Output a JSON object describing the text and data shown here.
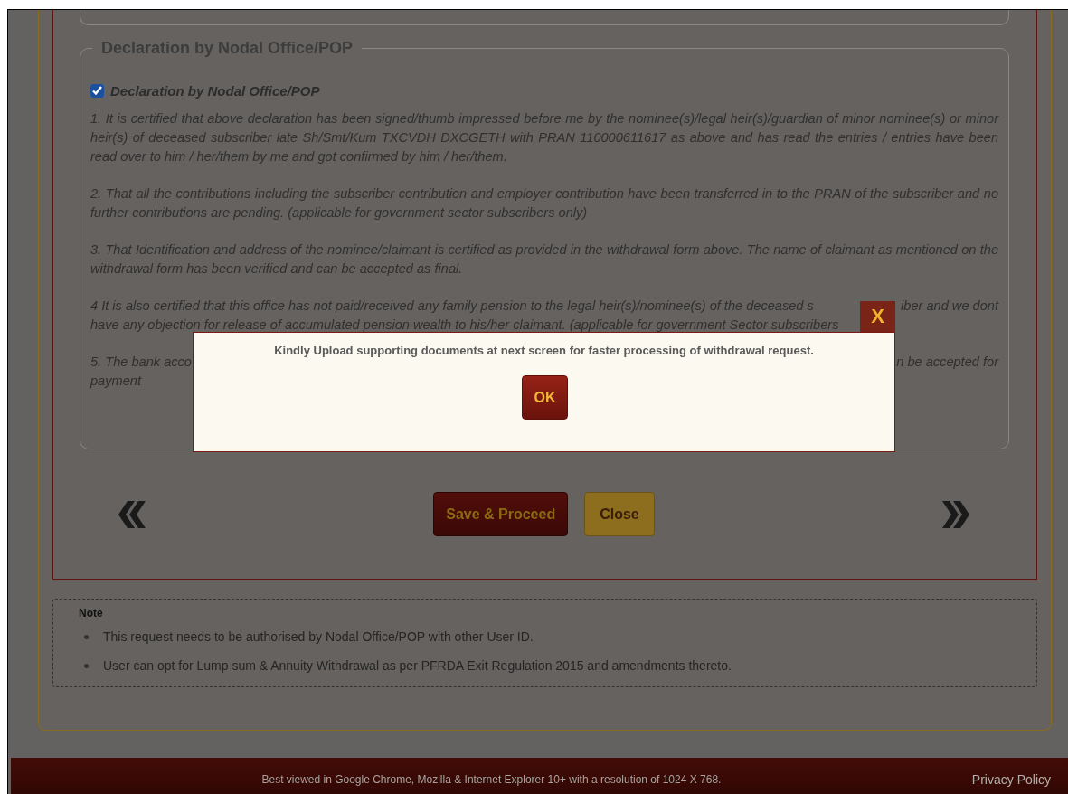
{
  "declaration": {
    "legend": "Declaration by Nodal Office/POP",
    "checkbox": {
      "label": "Declaration by Nodal Office/POP",
      "checked": true
    },
    "paragraphs": [
      {
        "kind": "text",
        "text": "1. It is certified that above declaration has been signed/thumb impressed before me by the nominee(s)/legal heir(s)/guardian of minor nominee(s) or minor heir(s) of deceased subscriber late Sh/Smt/Kum TXCVDH DXCGETH with PRAN 110000611617 as above and has read the entries / entries have been read over to him / her/them by me and got confirmed by him / her/them."
      },
      {
        "kind": "text",
        "text": "2. That all the contributions including the subscriber contribution and employer contribution have been transferred in to the PRAN of the subscriber and no further contributions are pending. (applicable for government sector subscribers only)"
      },
      {
        "kind": "text",
        "text": "3. That Identification and address of the nominee/claimant is certified as provided in the withdrawal form above. The name of claimant as mentioned on the withdrawal form has been verified and can be accepted as final."
      },
      {
        "kind": "covered",
        "lines": [
          {
            "left": "4 It is also certified that this office has not paid/received any family pension to the legal heir(s)/nominee(s) of the deceased s",
            "right": "iber and we dont"
          },
          {
            "left": "have any objection for release of accumulated pension wealth to his/her claimant. (applicable for government Sector subscribers"
          }
        ]
      },
      {
        "kind": "covered",
        "lines": [
          {
            "left": "5. The bank acco",
            "right": "n be accepted for"
          },
          {
            "left": "payment"
          }
        ]
      }
    ]
  },
  "buttons": [
    {
      "label": "Save & Proceed",
      "kind": "primary"
    },
    {
      "label": "Close",
      "kind": "secondary"
    }
  ],
  "note": {
    "title": "Note",
    "items": [
      "This request needs to be authorised by Nodal Office/POP with other User ID.",
      "User can opt for Lump sum & Annuity Withdrawal as per PFRDA Exit Regulation 2015 and amendments thereto."
    ]
  },
  "footer": {
    "text": "Best viewed in Google Chrome, Mozilla & Internet Explorer 10+ with a resolution of 1024 X 768.",
    "link": "Privacy Policy"
  },
  "dialog": {
    "close": "X",
    "message": "Kindly Upload supporting documents at next screen for faster processing of withdrawal request.",
    "button": "OK"
  }
}
